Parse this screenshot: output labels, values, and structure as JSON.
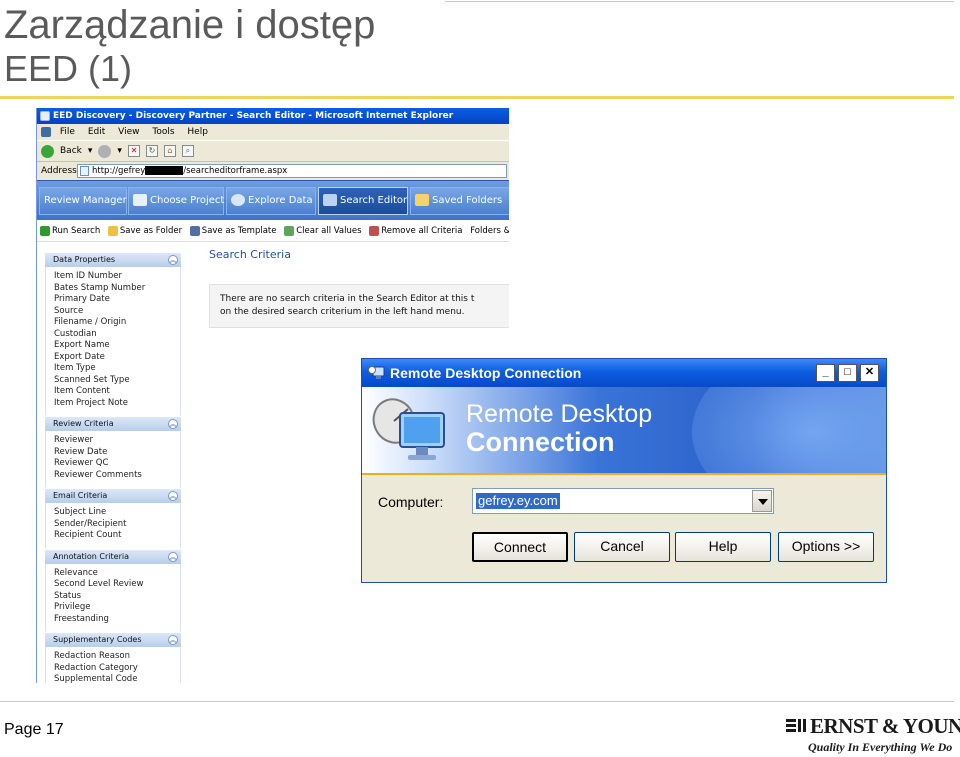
{
  "slide": {
    "title": "Zarządzanie i dostęp",
    "subtitle": "EED (1)",
    "page": "Page 17",
    "logo_name": "ERNST & YOUNG",
    "logo_tagline": "Quality In Everything We Do"
  },
  "browser": {
    "window_title": "EED Discovery - Discovery Partner - Search Editor - Microsoft Internet Explorer",
    "menu": [
      "File",
      "Edit",
      "View",
      "Tools",
      "Help"
    ],
    "back_label": "Back",
    "address_label": "Address",
    "url_prefix": "http://gefrey",
    "url_suffix": "/searcheditorframe.aspx"
  },
  "app": {
    "nav_tabs": [
      {
        "label": "Review Manager"
      },
      {
        "label": "Choose Project"
      },
      {
        "label": "Explore Data"
      },
      {
        "label": "Search Editor"
      },
      {
        "label": "Saved Folders"
      }
    ],
    "actions": [
      "Run Search",
      "Save as Folder",
      "Save as Template",
      "Clear all Values",
      "Remove all Criteria",
      "Folders & Templat"
    ],
    "sections": [
      {
        "title": "Data Properties",
        "items": [
          "Item ID Number",
          "Bates Stamp Number",
          "Primary Date",
          "Source",
          "Filename / Origin",
          "Custodian",
          "Export Name",
          "Export Date",
          "Item Type",
          "Scanned Set Type",
          "Item Content",
          "Item Project Note"
        ]
      },
      {
        "title": "Review Criteria",
        "items": [
          "Reviewer",
          "Review Date",
          "Reviewer QC",
          "Reviewer Comments"
        ]
      },
      {
        "title": "Email Criteria",
        "items": [
          "Subject Line",
          "Sender/Recipient",
          "Recipient Count"
        ]
      },
      {
        "title": "Annotation Criteria",
        "items": [
          "Relevance",
          "Second Level Review",
          "Status",
          "Privilege",
          "Freestanding"
        ]
      },
      {
        "title": "Supplementary Codes",
        "items": [
          "Redaction Reason",
          "Redaction Category",
          "Supplemental Code"
        ]
      }
    ],
    "search_heading": "Search Criteria",
    "empty_message_line1": "There are no search criteria in the Search Editor at this t",
    "empty_message_line2": "on the desired search criterium in the left hand menu."
  },
  "rdc": {
    "title": "Remote Desktop Connection",
    "banner_line1": "Remote Desktop",
    "banner_line2": "Connection",
    "computer_label": "Computer:",
    "computer_value": "gefrey.ey.com",
    "buttons": [
      "Connect",
      "Cancel",
      "Help",
      "Options >>"
    ],
    "window_controls": [
      "_",
      "□",
      "✕"
    ]
  },
  "colors": {
    "xp_blue": "#0749c9",
    "accent_gold": "#f2d35a",
    "selection": "#316ac5"
  }
}
